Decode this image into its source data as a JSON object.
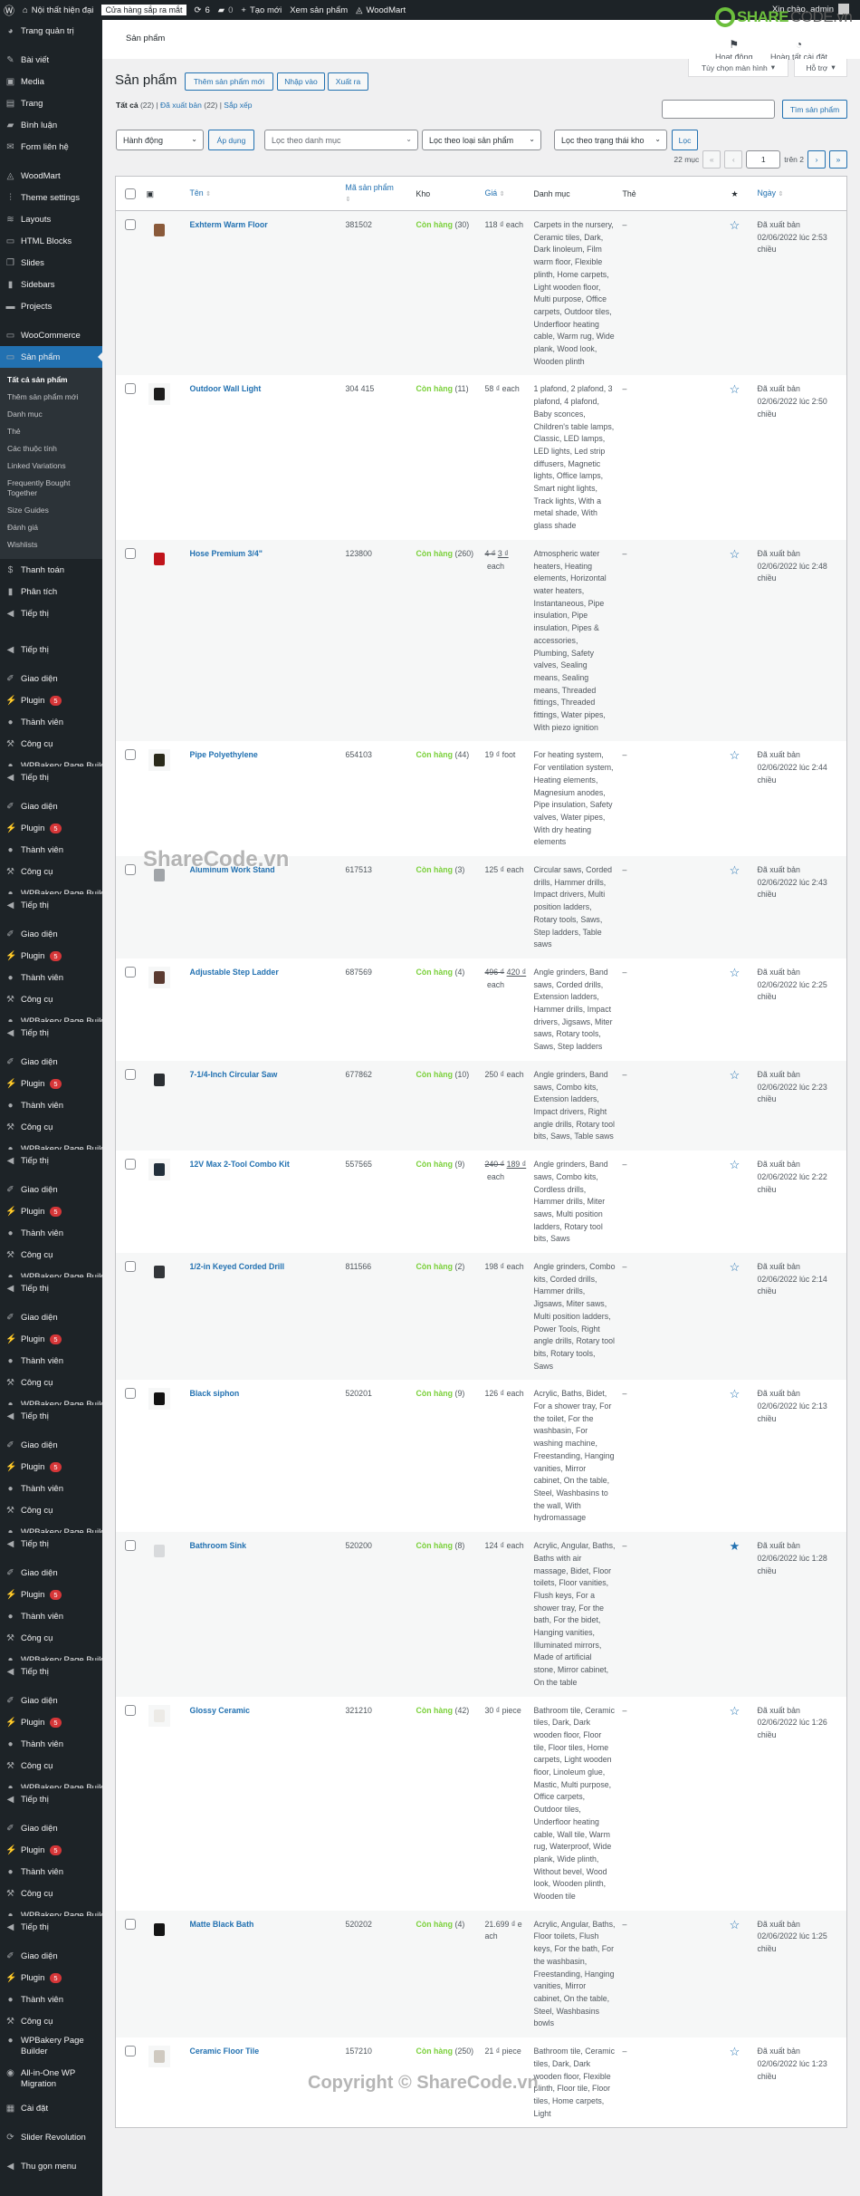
{
  "adminbar": {
    "site": "Nội thất hiện đại",
    "coming_soon": "Cửa hàng sắp ra mắt",
    "updates": "6",
    "comments": "0",
    "new": "Tạo mới",
    "view": "Xem sản phẩm",
    "theme": "WoodMart",
    "greeting": "Xin chào, admin"
  },
  "sidebar": {
    "top": [
      {
        "label": "Trang quản trị",
        "icon": "dashboard-icon"
      }
    ],
    "group1": [
      {
        "label": "Bài viết",
        "icon": "pin-icon"
      },
      {
        "label": "Media",
        "icon": "media-icon"
      },
      {
        "label": "Trang",
        "icon": "page-icon"
      },
      {
        "label": "Bình luận",
        "icon": "comment-icon"
      },
      {
        "label": "Form liên hệ",
        "icon": "mail-icon"
      }
    ],
    "group2": [
      {
        "label": "WoodMart",
        "icon": "woodmart-icon"
      },
      {
        "label": "Theme settings",
        "icon": "sliders-icon"
      },
      {
        "label": "Layouts",
        "icon": "layers-icon"
      },
      {
        "label": "HTML Blocks",
        "icon": "code-icon"
      },
      {
        "label": "Slides",
        "icon": "slides-icon"
      },
      {
        "label": "Sidebars",
        "icon": "sidebar-icon"
      },
      {
        "label": "Projects",
        "icon": "briefcase-icon"
      }
    ],
    "woocommerce": "WooCommerce",
    "products": "Sản phẩm",
    "submenu": [
      "Tất cả sản phẩm",
      "Thêm sản phẩm mới",
      "Danh mục",
      "Thẻ",
      "Các thuộc tính",
      "Linked Variations",
      "Frequently Bought Together",
      "Size Guides",
      "Đánh giá",
      "Wishlists"
    ],
    "after": [
      {
        "label": "Thanh toán",
        "icon": "payment-icon"
      },
      {
        "label": "Phân tích",
        "icon": "chart-icon"
      },
      {
        "label": "Tiếp thị",
        "icon": "megaphone-icon"
      }
    ],
    "repeated_block": [
      {
        "label": "Tiếp thị",
        "icon": "megaphone-icon"
      },
      {
        "label": "Giao diện",
        "icon": "brush-icon"
      },
      {
        "label": "Plugin",
        "icon": "plugin-icon",
        "badge": "5"
      },
      {
        "label": "Thành viên",
        "icon": "user-icon"
      },
      {
        "label": "Công cụ",
        "icon": "wrench-icon"
      },
      {
        "label": "WPBakery Page Builder",
        "icon": "wpbakery-icon"
      }
    ],
    "tail": [
      {
        "label": "WPBakery Page Builder",
        "icon": "wpbakery-icon"
      },
      {
        "label": "All-in-One WP Migration",
        "icon": "migration-icon"
      },
      {
        "label": "Cài đặt",
        "icon": "settings-icon"
      },
      {
        "label": "Slider Revolution",
        "icon": "revolution-icon"
      },
      {
        "label": "Thu gọn menu",
        "icon": "collapse-icon"
      }
    ]
  },
  "header": {
    "title": "Sản phẩm",
    "activity": "Hoạt động",
    "finish_setup": "Hoàn tất cài đặt",
    "screen_options": "Tùy chọn màn hình",
    "help": "Hỗ trợ"
  },
  "logo": {
    "text": "SHARECODE",
    "suffix": ".vn"
  },
  "page": {
    "title": "Sản phẩm",
    "add_new": "Thêm sản phẩm mới",
    "import": "Nhập vào",
    "export": "Xuất ra",
    "views": {
      "all": "Tất cả",
      "all_count": "(22)",
      "published": "Đã xuất bản",
      "published_count": "(22)",
      "sort": "Sắp xếp"
    },
    "search_button": "Tìm sản phẩm",
    "search_value": "",
    "bulk_action": "Hành động",
    "apply": "Áp dụng",
    "filter_category": "Lọc theo danh mục",
    "filter_type": "Lọc theo loại sản phẩm",
    "filter_stock": "Lọc theo trạng thái kho",
    "filter_button": "Lọc",
    "pagination": {
      "items": "22 mục",
      "current": "1",
      "of": "trên 2",
      "first": "«",
      "prev": "‹",
      "next": "›",
      "last": "»"
    }
  },
  "table": {
    "columns": {
      "name": "Tên",
      "sku": "Mã sản phẩm",
      "stock": "Kho",
      "price": "Giá",
      "categories": "Danh mục",
      "tags": "Thẻ",
      "featured": "★",
      "date": "Ngày"
    },
    "rows": [
      {
        "name": "Exhterm Warm Floor",
        "sku": "381502",
        "stock": "Còn hàng",
        "qty": "(30)",
        "price": "118 ₫ each",
        "cats": "Carpets in the nursery, Ceramic tiles, Dark, Dark linoleum, Film warm floor, Flexible plinth, Home carpets, Light wooden floor, Multi purpose, Office carpets, Outdoor tiles, Underfloor heating cable, Warm rug, Wide plank, Wood look, Wooden plinth",
        "tags": "–",
        "featured": false,
        "status": "Đã xuất bản",
        "date": "02/06/2022 lúc 2:53 chiều",
        "thumb": "#8a5a3a"
      },
      {
        "name": "Outdoor Wall Light",
        "sku": "304 415",
        "stock": "Còn hàng",
        "qty": "(11)",
        "price": "58 ₫ each",
        "cats": "1 plafond, 2 plafond, 3 plafond, 4 plafond, Baby sconces, Children's table lamps, Classic, LED lamps, LED lights, Led strip diffusers, Magnetic lights, Office lamps, Smart night lights, Track lights, With a metal shade, With glass shade",
        "tags": "–",
        "featured": false,
        "status": "Đã xuất bản",
        "date": "02/06/2022 lúc 2:50 chiều",
        "thumb": "#1d1d1d"
      },
      {
        "name": "Hose Premium 3/4\"",
        "sku": "123800",
        "stock": "Còn hàng",
        "qty": "(260)",
        "price_old": "4 ₫",
        "price_new": "3 ₫",
        "unit": "each",
        "cats": "Atmospheric water heaters, Heating elements, Horizontal water heaters, Instantaneous, Pipe insulation, Pipe insulation, Pipes & accessories, Plumbing, Safety valves, Sealing means, Sealing means, Threaded fittings, Threaded fittings, Water pipes, With piezo ignition",
        "tags": "–",
        "featured": false,
        "status": "Đã xuất bản",
        "date": "02/06/2022 lúc 2:48 chiều",
        "thumb": "#c0141b"
      },
      {
        "name": "Pipe Polyethylene",
        "sku": "654103",
        "stock": "Còn hàng",
        "qty": "(44)",
        "price": "19 ₫ foot",
        "cats": "For heating system, For ventilation system, Heating elements, Magnesium anodes, Pipe insulation, Safety valves, Water pipes, With dry heating elements",
        "tags": "–",
        "featured": false,
        "status": "Đã xuất bản",
        "date": "02/06/2022 lúc 2:44 chiều",
        "thumb": "#2a2a1a"
      },
      {
        "name": "Aluminum Work Stand",
        "sku": "617513",
        "stock": "Còn hàng",
        "qty": "(3)",
        "price": "125 ₫ each",
        "cats": "Circular saws, Corded drills, Hammer drills, Impact drivers, Multi position ladders, Rotary tools, Saws, Step ladders, Table saws",
        "tags": "–",
        "featured": false,
        "status": "Đã xuất bản",
        "date": "02/06/2022 lúc 2:43 chiều",
        "thumb": "#a0a4a8"
      },
      {
        "name": "Adjustable Step Ladder",
        "sku": "687569",
        "stock": "Còn hàng",
        "qty": "(4)",
        "price_old": "496 ₫",
        "price_new": "420 ₫",
        "unit": "each",
        "cats": "Angle grinders, Band saws, Corded drills, Extension ladders, Hammer drills, Impact drivers, Jigsaws, Miter saws, Rotary tools, Saws, Step ladders",
        "tags": "–",
        "featured": false,
        "status": "Đã xuất bản",
        "date": "02/06/2022 lúc 2:25 chiều",
        "thumb": "#5a3a30"
      },
      {
        "name": "7-1/4-Inch Circular Saw",
        "sku": "677862",
        "stock": "Còn hàng",
        "qty": "(10)",
        "price": "250 ₫ each",
        "cats": "Angle grinders, Band saws, Combo kits, Extension ladders, Impact drivers, Right angle drills, Rotary tool bits, Saws, Table saws",
        "tags": "–",
        "featured": false,
        "status": "Đã xuất bản",
        "date": "02/06/2022 lúc 2:23 chiều",
        "thumb": "#2b2f33"
      },
      {
        "name": "12V Max 2-Tool Combo Kit",
        "sku": "557565",
        "stock": "Còn hàng",
        "qty": "(9)",
        "price_old": "240 ₫",
        "price_new": "189 ₫",
        "unit": "each",
        "cats": "Angle grinders, Band saws, Combo kits, Cordless drills, Hammer drills, Miter saws, Multi position ladders, Rotary tool bits, Saws",
        "tags": "–",
        "featured": false,
        "status": "Đã xuất bản",
        "date": "02/06/2022 lúc 2:22 chiều",
        "thumb": "#22303c"
      },
      {
        "name": "1/2-in Keyed Corded Drill",
        "sku": "811566",
        "stock": "Còn hàng",
        "qty": "(2)",
        "price": "198 ₫ each",
        "cats": "Angle grinders, Combo kits, Corded drills, Hammer drills, Jigsaws, Miter saws, Multi position ladders, Power Tools, Right angle drills, Rotary tool bits, Rotary tools, Saws",
        "tags": "–",
        "featured": false,
        "status": "Đã xuất bản",
        "date": "02/06/2022 lúc 2:14 chiều",
        "thumb": "#33363a"
      },
      {
        "name": "Black siphon",
        "sku": "520201",
        "stock": "Còn hàng",
        "qty": "(9)",
        "price": "126 ₫ each",
        "cats": "Acrylic, Baths, Bidet, For a shower tray, For the toilet, For the washbasin, For washing machine, Freestanding, Hanging vanities, Mirror cabinet, On the table, Steel, Washbasins to the wall, With hydromassage",
        "tags": "–",
        "featured": false,
        "status": "Đã xuất bản",
        "date": "02/06/2022 lúc 2:13 chiều",
        "thumb": "#111111"
      },
      {
        "name": "Bathroom Sink",
        "sku": "520200",
        "stock": "Còn hàng",
        "qty": "(8)",
        "price": "124 ₫ each",
        "cats": "Acrylic, Angular, Baths, Baths with air massage, Bidet, Floor toilets, Floor vanities, Flush keys, For a shower tray, For the bath, For the bidet, Hanging vanities, Illuminated mirrors, Made of artificial stone, Mirror cabinet, On the table",
        "tags": "–",
        "featured": true,
        "status": "Đã xuất bản",
        "date": "02/06/2022 lúc 1:28 chiều",
        "thumb": "#d8dadc"
      },
      {
        "name": "Glossy Ceramic",
        "sku": "321210",
        "stock": "Còn hàng",
        "qty": "(42)",
        "price": "30 ₫ piece",
        "cats": "Bathroom tile, Ceramic tiles, Dark, Dark wooden floor, Floor tile, Floor tiles, Home carpets, Light wooden floor, Linoleum glue, Mastic, Multi purpose, Office carpets, Outdoor tiles, Underfloor heating cable, Wall tile, Warm rug, Waterproof, Wide plank, Wide plinth, Without bevel, Wood look, Wooden plinth, Wooden tile",
        "tags": "–",
        "featured": false,
        "status": "Đã xuất bản",
        "date": "02/06/2022 lúc 1:26 chiều",
        "thumb": "#eceae6"
      },
      {
        "name": "Matte Black Bath",
        "sku": "520202",
        "stock": "Còn hàng",
        "qty": "(4)",
        "price": "21.699 ₫ each",
        "cats": "Acrylic, Angular, Baths, Floor toilets, Flush keys, For the bath, For the washbasin, Freestanding, Hanging vanities, Mirror cabinet, On the table, Steel, Washbasins bowls",
        "tags": "–",
        "featured": false,
        "status": "Đã xuất bản",
        "date": "02/06/2022 lúc 1:25 chiều",
        "thumb": "#151515"
      },
      {
        "name": "Ceramic Floor Tile",
        "sku": "157210",
        "stock": "Còn hàng",
        "qty": "(250)",
        "price": "21 ₫ piece",
        "cats": "Bathroom tile, Ceramic tiles, Dark, Dark wooden floor, Flexible plinth, Floor tile, Floor tiles, Home carpets, Light",
        "tags": "–",
        "featured": false,
        "status": "Đã xuất bản",
        "date": "02/06/2022 lúc 1:23 chiều",
        "thumb": "#cfc9c0"
      }
    ]
  },
  "watermarks": [
    "ShareCode.vn",
    "Copyright © ShareCode.vn"
  ],
  "colors": {
    "accent": "#2271b1",
    "instock": "#7ad03a",
    "sidebar": "#1d2327",
    "badge": "#d63638"
  }
}
